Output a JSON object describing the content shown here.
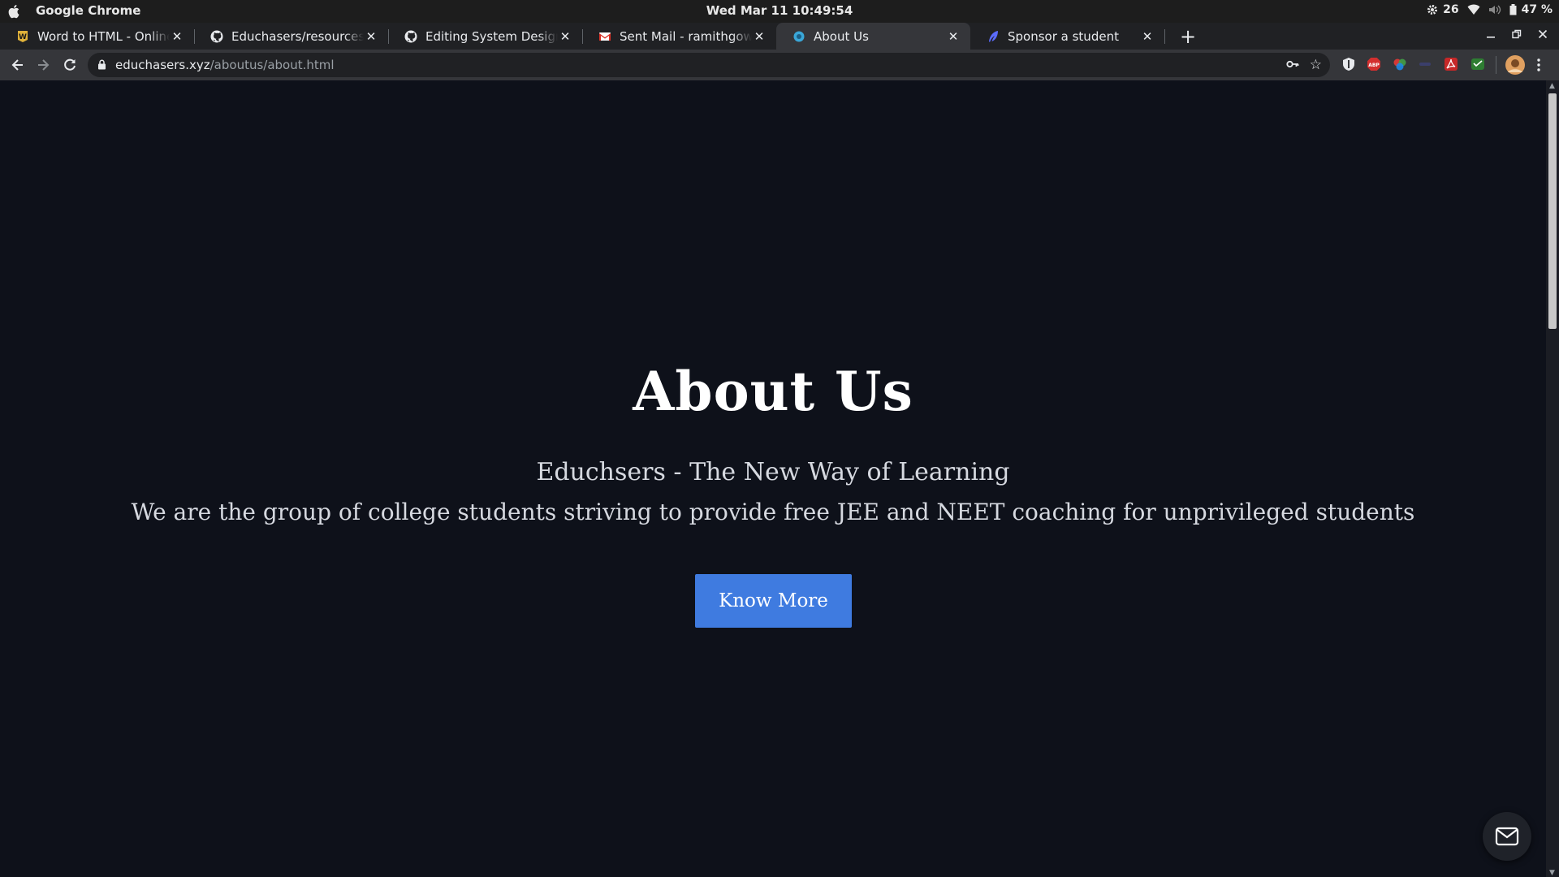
{
  "system_bar": {
    "app_name": "Google Chrome",
    "clock": "Wed Mar 11  10:49:54",
    "temperature": "26",
    "battery": "47 %"
  },
  "tabs": [
    {
      "title": "Word to HTML - Online Converter",
      "icon": "word-to-html-icon",
      "active": false
    },
    {
      "title": "Educhasers/resources_website",
      "icon": "github-icon",
      "active": false
    },
    {
      "title": "Editing System Design · ramith",
      "icon": "github-icon",
      "active": false
    },
    {
      "title": "Sent Mail - ramithgowdak",
      "icon": "gmail-icon",
      "active": false
    },
    {
      "title": "About Us",
      "icon": "site-favicon",
      "active": true
    },
    {
      "title": "Sponsor a student",
      "icon": "feather-icon",
      "active": false
    }
  ],
  "toolbar": {
    "url_host": "educhasers.xyz",
    "url_path": "/aboutus/about.html"
  },
  "hero": {
    "title": "About Us",
    "subtitle": "Educhsers - The New Way of Learning",
    "description": "We are the group of college students striving to provide free JEE and NEET coaching for unprivileged students",
    "cta_label": "Know More"
  },
  "colors": {
    "page_background": "#0e111a",
    "button_blue": "#3f7be0"
  }
}
